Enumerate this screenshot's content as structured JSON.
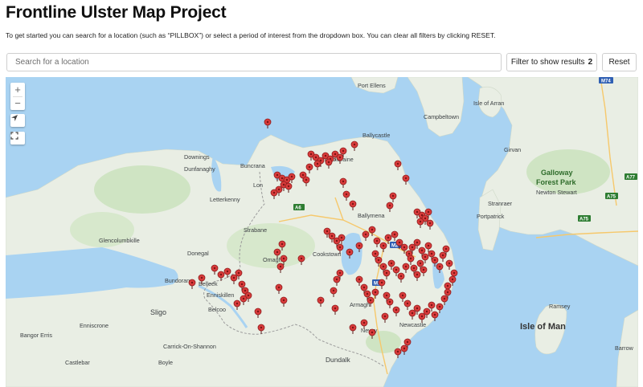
{
  "page": {
    "title": "Frontline Ulster Map Project",
    "intro": "To get started you can search for a location (such as “PILLBOX”) or select a period of interest from the dropdown box. You can clear all filters by clicking RESET."
  },
  "search": {
    "placeholder": "Search for a location",
    "value": ""
  },
  "filter_button": {
    "label": "Filter to show results",
    "count": "2"
  },
  "reset_button": {
    "label": "Reset"
  },
  "map": {
    "controls": [
      "zoom-in",
      "zoom-out",
      "locate",
      "fullscreen"
    ],
    "zoom_in_glyph": "+",
    "zoom_out_glyph": "−",
    "marker_color": "#d93b3b",
    "water_color": "#a9d3f2",
    "land_color": "#e9eee4",
    "place_labels": [
      "Port Ellens",
      "Isle of Arran",
      "Campbeltown",
      "Ballycastle",
      "Downings",
      "Buncrana",
      "Dunfanaghy",
      "Coleraine",
      "Girvan",
      "Galloway",
      "Forest Park",
      "Newton Stewart",
      "Stranraer",
      "Portpatrick",
      "Letterkenny",
      "Ballymena",
      "Strabane",
      "Glencolumbkille",
      "Cookstown",
      "Omagh",
      "Donegal",
      "Bundoran",
      "Belleek",
      "Enniskillen",
      "Belcoo",
      "Armagh",
      "Sligo",
      "Enniscrone",
      "Newry",
      "Newcastle",
      "Isle of Man",
      "Ramsey",
      "Barrow",
      "Carrick-On-Shannon",
      "Dundalk",
      "Castlebar",
      "Bangor Erris",
      "Boyle",
      "Lon"
    ],
    "road_shields": [
      "M74",
      "A6",
      "M1",
      "A75",
      "A75",
      "A77",
      "M2"
    ]
  }
}
